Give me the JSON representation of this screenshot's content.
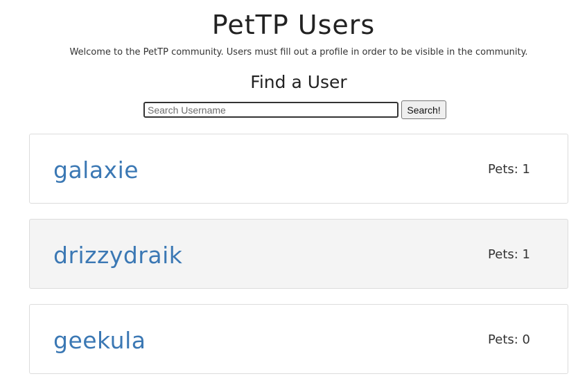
{
  "header": {
    "title": "PetTP Users",
    "welcome": "Welcome to the PetTP community. Users must fill out a profile in order to be visible in the community."
  },
  "search": {
    "heading": "Find a User",
    "placeholder": "Search Username",
    "value": "",
    "button_label": "Search!"
  },
  "users": [
    {
      "username": "galaxie",
      "pets": "Pets: 1"
    },
    {
      "username": "drizzydraik",
      "pets": "Pets: 1"
    },
    {
      "username": "geekula",
      "pets": "Pets: 0"
    }
  ]
}
